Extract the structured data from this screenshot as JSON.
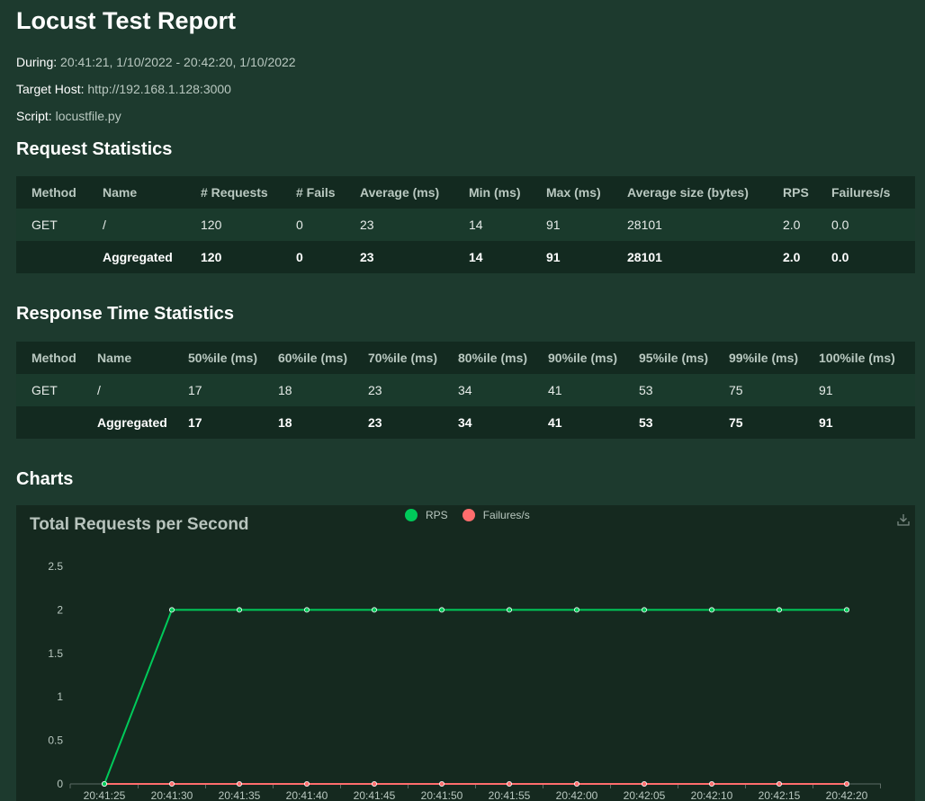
{
  "report": {
    "title": "Locust Test Report",
    "during_label": "During:",
    "during_value": "20:41:21, 1/10/2022 - 20:42:20, 1/10/2022",
    "host_label": "Target Host:",
    "host_value": "http://192.168.1.128:3000",
    "script_label": "Script:",
    "script_value": "locustfile.py"
  },
  "request_stats": {
    "heading": "Request Statistics",
    "columns": [
      "Method",
      "Name",
      "# Requests",
      "# Fails",
      "Average (ms)",
      "Min (ms)",
      "Max (ms)",
      "Average size (bytes)",
      "RPS",
      "Failures/s"
    ],
    "rows": [
      [
        "GET",
        "/",
        "120",
        "0",
        "23",
        "14",
        "91",
        "28101",
        "2.0",
        "0.0"
      ],
      [
        "",
        "Aggregated",
        "120",
        "0",
        "23",
        "14",
        "91",
        "28101",
        "2.0",
        "0.0"
      ]
    ]
  },
  "response_stats": {
    "heading": "Response Time Statistics",
    "columns": [
      "Method",
      "Name",
      "50%ile (ms)",
      "60%ile (ms)",
      "70%ile (ms)",
      "80%ile (ms)",
      "90%ile (ms)",
      "95%ile (ms)",
      "99%ile (ms)",
      "100%ile (ms)"
    ],
    "rows": [
      [
        "GET",
        "/",
        "17",
        "18",
        "23",
        "34",
        "41",
        "53",
        "75",
        "91"
      ],
      [
        "",
        "Aggregated",
        "17",
        "18",
        "23",
        "34",
        "41",
        "53",
        "75",
        "91"
      ]
    ]
  },
  "charts": {
    "heading": "Charts",
    "download_icon": "download-icon"
  },
  "colors": {
    "rps": "#00ca5a",
    "failures": "#ff6d6d"
  },
  "chart_data": {
    "type": "line",
    "title": "Total Requests per Second",
    "x": [
      "20:41:25",
      "20:41:30",
      "20:41:35",
      "20:41:40",
      "20:41:45",
      "20:41:50",
      "20:41:55",
      "20:42:00",
      "20:42:05",
      "20:42:10",
      "20:42:15",
      "20:42:20"
    ],
    "series": [
      {
        "name": "RPS",
        "values": [
          0,
          2,
          2,
          2,
          2,
          2,
          2,
          2,
          2,
          2,
          2,
          2
        ]
      },
      {
        "name": "Failures/s",
        "values": [
          0,
          0,
          0,
          0,
          0,
          0,
          0,
          0,
          0,
          0,
          0,
          0
        ]
      }
    ],
    "y_ticks": [
      "0",
      "0.5",
      "1",
      "1.5",
      "2",
      "2.5"
    ],
    "ylim": [
      0,
      2.5
    ],
    "legend": "top-center",
    "grid": false
  }
}
